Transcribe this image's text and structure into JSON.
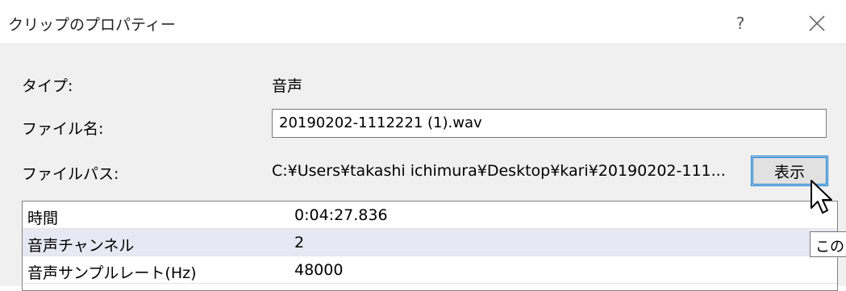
{
  "dialog": {
    "title": "クリップのプロパティー",
    "help_label": "?",
    "close_label": "✕"
  },
  "fields": {
    "type_label": "タイプ:",
    "type_value": "音声",
    "filename_label": "ファイル名:",
    "filename_value": "20190202-1112221 (1).wav",
    "filepath_label": "ファイルパス:",
    "filepath_value": "C:¥Users¥takashi ichimura¥Desktop¥kari¥20190202-111...",
    "show_button_label": "表示"
  },
  "properties": {
    "rows": [
      {
        "name": "時間",
        "value": "0:04:27.836"
      },
      {
        "name": "音声チャンネル",
        "value": "2"
      },
      {
        "name": "音声サンプルレート(Hz)",
        "value": "48000"
      }
    ]
  },
  "tooltip": {
    "text": "この"
  }
}
